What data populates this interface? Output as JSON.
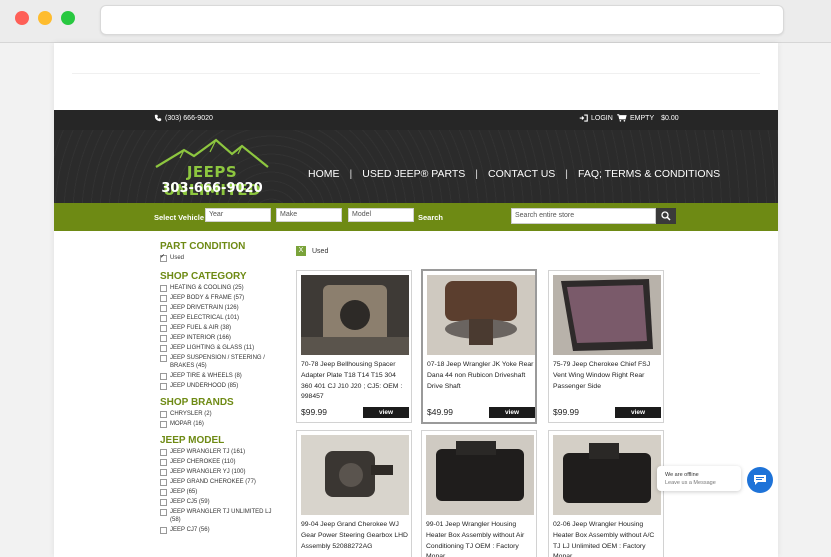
{
  "header": {
    "phone": "(303) 666-9020",
    "login": "LOGIN",
    "cart_status": "EMPTY",
    "cart_total": "$0.00",
    "logo_name": "JEEPS UNLIMITED",
    "logo_phone": "303-666-9020"
  },
  "nav": [
    "HOME",
    "USED JEEP® PARTS",
    "CONTACT US",
    "FAQ; TERMS & CONDITIONS"
  ],
  "vehicle_bar": {
    "label": "Select Vehicle",
    "year_placeholder": "Year",
    "make_placeholder": "Make",
    "model_placeholder": "Model",
    "search_label": "Search",
    "store_search_placeholder": "Search entire store"
  },
  "sidebar": {
    "part_condition": {
      "title": "PART CONDITION",
      "items": [
        {
          "label": "Used",
          "checked": true
        }
      ]
    },
    "shop_category": {
      "title": "SHOP CATEGORY",
      "items": [
        "HEATING & COOLING (25)",
        "JEEP BODY & FRAME (57)",
        "JEEP DRIVETRAIN (126)",
        "JEEP ELECTRICAL (101)",
        "JEEP FUEL & AIR (38)",
        "JEEP INTERIOR (166)",
        "JEEP LIGHTING & GLASS (11)",
        "JEEP SUSPENSION / STEERING / BRAKES (45)",
        "JEEP TIRE & WHEELS (8)",
        "JEEP UNDERHOOD (85)"
      ]
    },
    "shop_brands": {
      "title": "SHOP BRANDS",
      "items": [
        "CHRYSLER (2)",
        "MOPAR (16)"
      ]
    },
    "jeep_model": {
      "title": "JEEP MODEL",
      "items": [
        "JEEP WRANGLER TJ (161)",
        "JEEP CHEROKEE (110)",
        "JEEP WRANGLER YJ (100)",
        "JEEP GRAND CHEROKEE (77)",
        "JEEP (65)",
        "JEEP CJ5 (59)",
        "JEEP WRANGLER TJ UNLIMITED LJ (58)",
        "JEEP CJ7 (56)"
      ]
    }
  },
  "active_filter": "Used",
  "products": [
    {
      "title": "70-78 Jeep Bellhousing Spacer Adapter Plate T18 T14 T15 304 360 401 CJ J10 J20 ; CJ5: OEM : 998457",
      "price": "$99.99",
      "view": "view"
    },
    {
      "title": "07-18 Jeep Wrangler JK Yoke Rear Dana 44 non Rubicon Driveshaft Drive Shaft",
      "price": "$49.99",
      "view": "view"
    },
    {
      "title": "75-79 Jeep Cherokee Chief FSJ Vent Wing Window Right Rear Passenger Side",
      "price": "$99.99",
      "view": "view"
    },
    {
      "title": "99-04 Jeep Grand Cherokee WJ Gear Power Steering Gearbox LHD Assembly 52088272AG",
      "price": "",
      "view": ""
    },
    {
      "title": "99-01 Jeep Wrangler Housing Heater Box Assembly without Air Conditioning TJ OEM : Factory Mopar",
      "price": "",
      "view": ""
    },
    {
      "title": "02-06 Jeep Wrangler Housing Heater Box Assembly without A/C TJ LJ Unlimited OEM : Factory Mopar",
      "price": "",
      "view": ""
    }
  ],
  "chat": {
    "status": "We are offline",
    "cta": "Leave us a Message"
  },
  "colors": {
    "accent_green": "#6e8a14",
    "dark_bar": "#262626",
    "chat_blue": "#1e73d8"
  }
}
